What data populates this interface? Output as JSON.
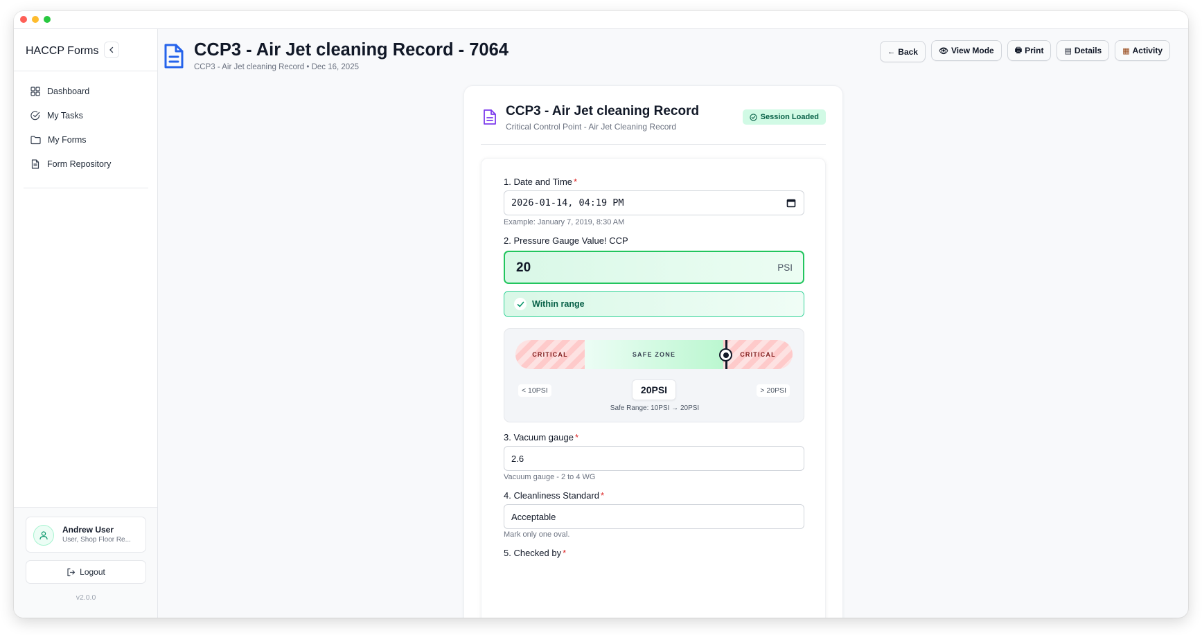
{
  "sidebar": {
    "brand": "HACCP Forms",
    "items": [
      {
        "label": "Dashboard",
        "icon": "grid-icon"
      },
      {
        "label": "My Tasks",
        "icon": "check-circle-icon"
      },
      {
        "label": "My Forms",
        "icon": "folder-icon"
      },
      {
        "label": "Form Repository",
        "icon": "document-icon"
      }
    ],
    "user": {
      "name": "Andrew User",
      "role": "User, Shop Floor Re..."
    },
    "logout_label": "Logout",
    "version": "v2.0.0"
  },
  "header": {
    "title": "CCP3 - Air Jet cleaning Record - 7064",
    "subtitle": "CCP3 - Air Jet cleaning Record • Dec 16, 2025",
    "actions": {
      "back": "Back",
      "view_mode": "View Mode",
      "print": "Print",
      "details": "Details",
      "activity": "Activity"
    }
  },
  "form": {
    "title": "CCP3 - Air Jet cleaning Record",
    "subtitle": "Critical Control Point - Air Jet Cleaning Record",
    "session_badge": "Session Loaded",
    "q1": {
      "label": "1. Date and Time",
      "value": "2026-01-14, 04:19 PM",
      "hint": "Example: January 7, 2019, 8:30 AM"
    },
    "q2": {
      "label": "2. Pressure Gauge Value! CCP",
      "value": "20",
      "unit": "PSI",
      "status": "Within range",
      "gauge": {
        "critical_low_label": "CRITICAL",
        "safe_label": "SAFE ZONE",
        "critical_high_label": "CRITICAL",
        "min_label": "< 10PSI",
        "max_label": "> 20PSI",
        "current_label": "20PSI",
        "safe_range_text": "Safe Range: 10PSI → 20PSI",
        "position_fraction": 0.76
      }
    },
    "q3": {
      "label": "3. Vacuum gauge",
      "value": "2.6",
      "hint": "Vacuum gauge - 2 to 4 WG"
    },
    "q4": {
      "label": "4. Cleanliness Standard",
      "value": "Acceptable",
      "hint": "Mark only one oval."
    },
    "q5": {
      "label": "5. Checked by"
    }
  },
  "colors": {
    "accent_blue": "#2563eb",
    "accent_purple": "#7c3aed",
    "success": "#22c55e",
    "required": "#dc2626"
  }
}
